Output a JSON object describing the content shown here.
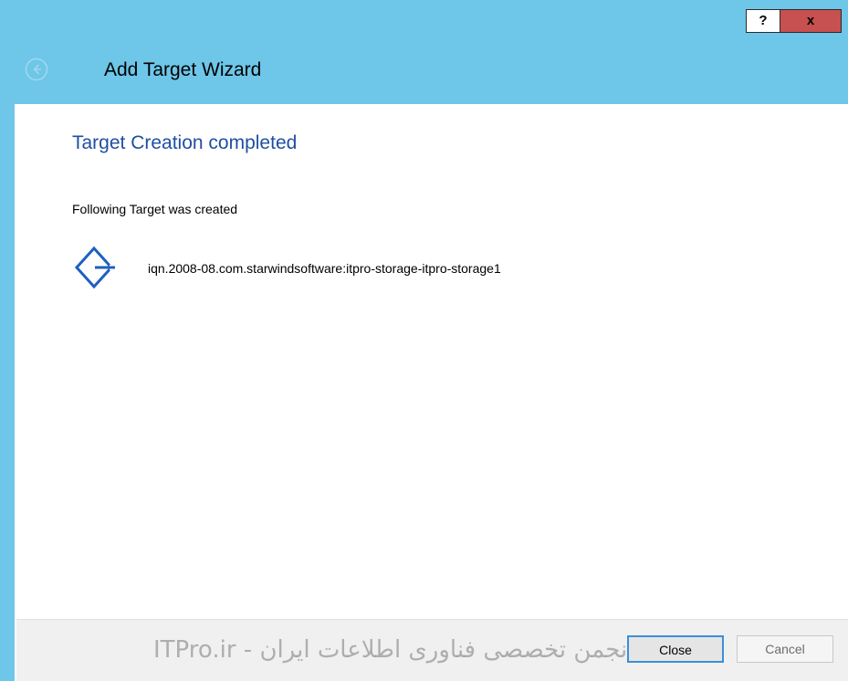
{
  "window": {
    "title": "Add Target Wizard",
    "help_label": "?",
    "close_label": "x"
  },
  "content": {
    "heading": "Target Creation completed",
    "info_text": "Following Target was created",
    "target_name": "iqn.2008-08.com.starwindsoftware:itpro-storage-itpro-storage1"
  },
  "footer": {
    "close_label": "Close",
    "cancel_label": "Cancel"
  },
  "watermark": {
    "text": "ITPro.ir - انجمن تخصصی فناوری اطلاعات ایران"
  },
  "colors": {
    "title_bar": "#6ec6e8",
    "heading": "#1f4fa3",
    "close_button": "#c75050",
    "icon": "#1f5fbf",
    "default_button_border": "#3c8fd6"
  },
  "icons": {
    "back": "back-arrow-icon",
    "target": "target-diamond-icon"
  }
}
